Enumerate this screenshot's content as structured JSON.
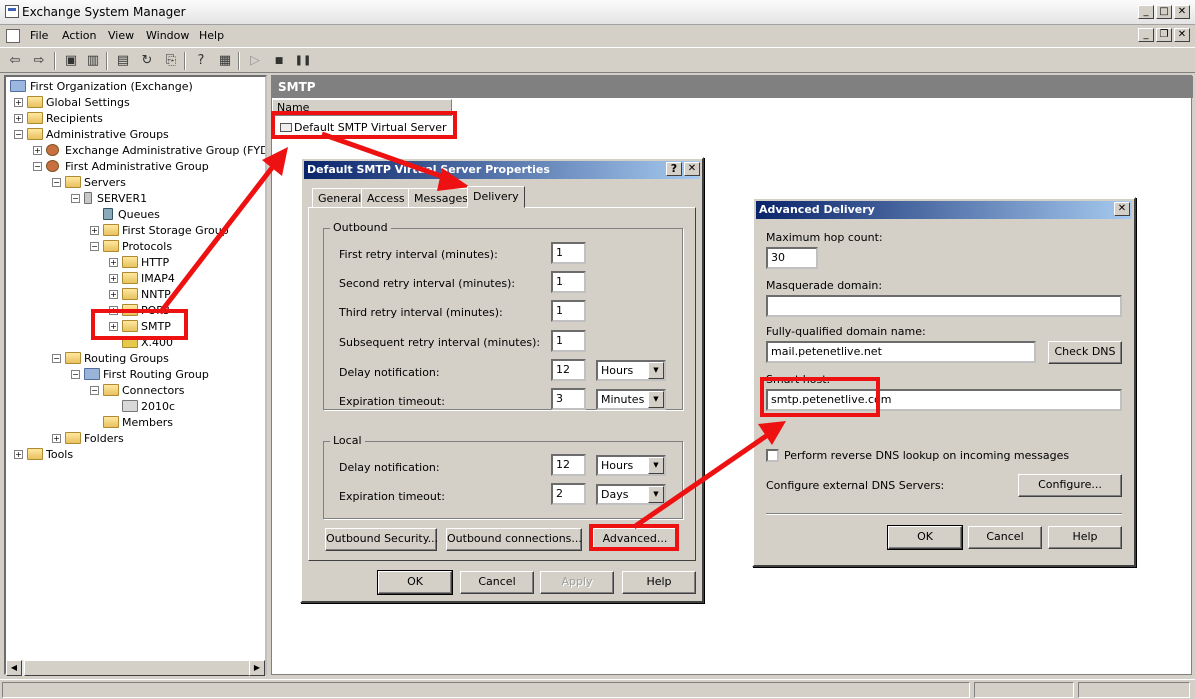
{
  "window": {
    "title": "Exchange System Manager"
  },
  "menu": [
    "File",
    "Action",
    "View",
    "Window",
    "Help"
  ],
  "tree": {
    "root": "First Organization (Exchange)",
    "items": [
      "Global Settings",
      "Recipients",
      "Administrative Groups",
      "Exchange Administrative Group (FYDIBOH",
      "First Administrative Group",
      "Servers",
      "SERVER1",
      "Queues",
      "First Storage Group",
      "Protocols",
      "HTTP",
      "IMAP4",
      "NNTP",
      "POP3",
      "SMTP",
      "X.400",
      "Routing Groups",
      "First Routing Group",
      "Connectors",
      "2010c",
      "Members",
      "Folders",
      "Tools"
    ]
  },
  "rightpane": {
    "header": "SMTP",
    "column": "Name",
    "item": "Default SMTP Virtual Server"
  },
  "props": {
    "title": "Default SMTP Virtual Server Properties",
    "tabs": [
      "General",
      "Access",
      "Messages",
      "Delivery"
    ],
    "outbound": {
      "label": "Outbound",
      "first": {
        "label": "First retry interval (minutes):",
        "value": "1"
      },
      "second": {
        "label": "Second retry interval (minutes):",
        "value": "1"
      },
      "third": {
        "label": "Third retry interval (minutes):",
        "value": "1"
      },
      "subsequent": {
        "label": "Subsequent retry interval (minutes):",
        "value": "1"
      },
      "delay": {
        "label": "Delay notification:",
        "value": "12",
        "unit": "Hours"
      },
      "expiration": {
        "label": "Expiration timeout:",
        "value": "3",
        "unit": "Minutes"
      }
    },
    "local": {
      "label": "Local",
      "delay": {
        "label": "Delay notification:",
        "value": "12",
        "unit": "Hours"
      },
      "expiration": {
        "label": "Expiration timeout:",
        "value": "2",
        "unit": "Days"
      }
    },
    "buttons": {
      "outbound_security": "Outbound Security...",
      "outbound_connections": "Outbound connections...",
      "advanced": "Advanced...",
      "ok": "OK",
      "cancel": "Cancel",
      "apply": "Apply",
      "help": "Help"
    }
  },
  "advanced": {
    "title": "Advanced Delivery",
    "max_hop": {
      "label": "Maximum hop count:",
      "value": "30"
    },
    "masquerade": {
      "label": "Masquerade domain:",
      "value": ""
    },
    "fqdn": {
      "label": "Fully-qualified domain name:",
      "value": "mail.petenetlive.net"
    },
    "check_dns": "Check DNS",
    "smarthost": {
      "label": "Smart host:",
      "value": "smtp.petenetlive.com"
    },
    "reverse_dns": "Perform reverse DNS lookup on incoming messages",
    "ext_dns": "Configure external DNS Servers:",
    "configure": "Configure...",
    "buttons": {
      "ok": "OK",
      "cancel": "Cancel",
      "help": "Help"
    }
  }
}
